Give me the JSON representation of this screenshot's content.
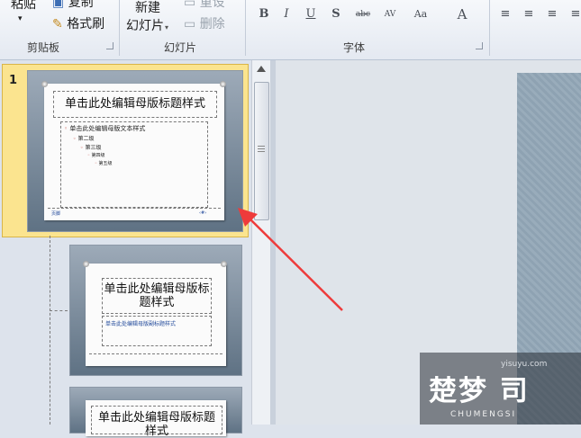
{
  "ribbon": {
    "clipboard": {
      "paste": "粘贴",
      "copy": "复制",
      "format_painter": "格式刷",
      "group_label": "剪贴板"
    },
    "slides": {
      "new_slide": "新建",
      "new_slide2": "幻灯片",
      "reset": "重设",
      "delete": "删除",
      "group_label": "幻灯片"
    },
    "font": {
      "group_label": "字体",
      "buttons": [
        "B",
        "I",
        "U",
        "S",
        "abc",
        "AV",
        "Aa",
        "A"
      ]
    }
  },
  "slides_panel": {
    "selected_number": "1",
    "master": {
      "title": "单击此处编辑母版标题样式",
      "body": [
        "单击此处编辑母版文本样式",
        "第二级",
        "第三级",
        "第四级",
        "第五级"
      ],
      "footer_left": "页脚",
      "footer_right": "‹#›"
    },
    "layout1": {
      "title": "单击此处编辑母版标题样式",
      "subtitle": "单击此处编辑母版副标题样式"
    },
    "layout2": {
      "title": "单击此处编辑母版标题样式"
    }
  },
  "watermark": {
    "site": "yisuyu.com",
    "brand": "楚梦 司",
    "brand_en": "CHUMENGSI"
  },
  "colors": {
    "selection": "#fbe48f",
    "arrow": "#ee3b3b",
    "ribbon_bg": "#eef1f6"
  }
}
